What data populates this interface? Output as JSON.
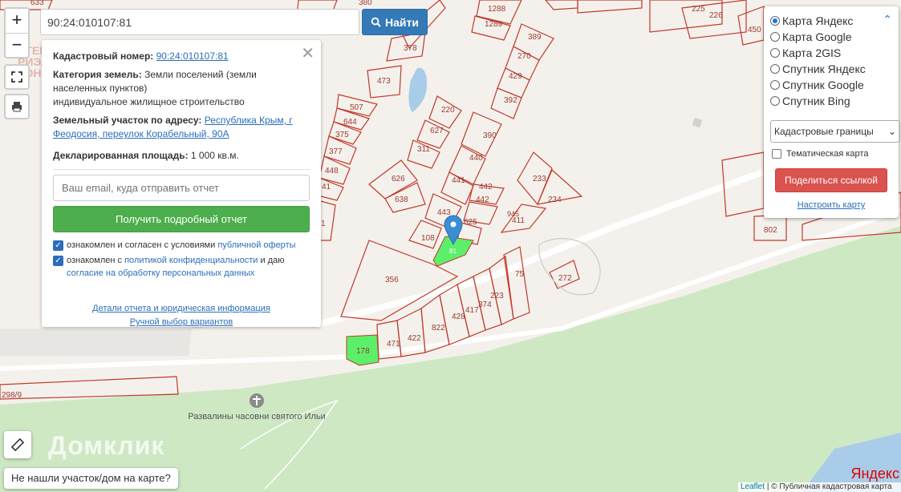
{
  "search": {
    "value": "90:24:010107:81",
    "button_label": "Найти"
  },
  "zoom": {
    "in_label": "+",
    "out_label": "−"
  },
  "panel": {
    "cadastral_label": "Кадастровый номер:",
    "cadastral_value": "90:24:010107:81",
    "category_label": "Категория земель:",
    "category_value": "Земли поселений (земли населенных пунктов)",
    "use_value": "индивидуальное жилищное строительство",
    "address_label": "Земельный участок по адресу:",
    "address_value": "Республика Крым, г Феодосия, переулок Корабельный, 90А",
    "area_label": "Декларированная площадь:",
    "area_value": "1 000 кв.м.",
    "email_placeholder": "Ваш email, куда отправить отчет",
    "report_button": "Получить подробный отчет",
    "consent1_prefix": "ознакомлен и согласен с условиями",
    "consent1_link": "публичной оферты",
    "consent2_prefix": "ознакомлен с",
    "consent2_link": "политикой конфиденциальности",
    "consent2_middle": "и даю",
    "consent2_link2": "согласие на обработку персональных данных",
    "details_link": "Детали отчета и юридическая информация",
    "manual_link": "Ручной выбор вариантов"
  },
  "layers": {
    "options": [
      "Карта Яндекс",
      "Карта Google",
      "Карта 2GIS",
      "Спутник Яндекс",
      "Спутник Google",
      "Спутник Bing"
    ],
    "selected_index": 0,
    "overlay_select": "Кадастровые границы",
    "thematic_label": "Тематическая карта",
    "share_button": "Поделиться ссылкой",
    "setup_link": "Настроить карту"
  },
  "map_labels": {
    "parcels": [
      "380",
      "1288",
      "1289",
      "378",
      "389",
      "270",
      "429",
      "392",
      "473",
      "507",
      "644",
      "375",
      "377",
      "448",
      "220",
      "627",
      "311",
      "390",
      "440",
      "441",
      "442",
      "442",
      "443",
      "625",
      "626",
      "638",
      "233",
      "234",
      "411",
      "108",
      "356",
      "178",
      "471",
      "422",
      "822",
      "428",
      "417",
      "374",
      "223",
      "75",
      "272",
      "802",
      "450",
      "226",
      "225",
      "633",
      "81",
      "298/9",
      "945",
      "41",
      "1"
    ],
    "place_name": "Развалины часовни святого Ильи",
    "watermark_domclick": "Домклик",
    "watermark_agency": "АГЕНТСТВО РИЭЛТОРСКОГО КОНС"
  },
  "footer": {
    "not_found": "Не нашли участок/дом на карте?",
    "attribution_leaflet": "Leaflet",
    "attribution_rest": "| © Публичная кадастровая карта",
    "provider_logo": "Яндекс"
  },
  "colors": {
    "parcel_stroke": "#c0392b",
    "parcel_highlight": "#5cf06a",
    "park": "#cfe8c4",
    "map_bg": "#f4f1ec"
  }
}
